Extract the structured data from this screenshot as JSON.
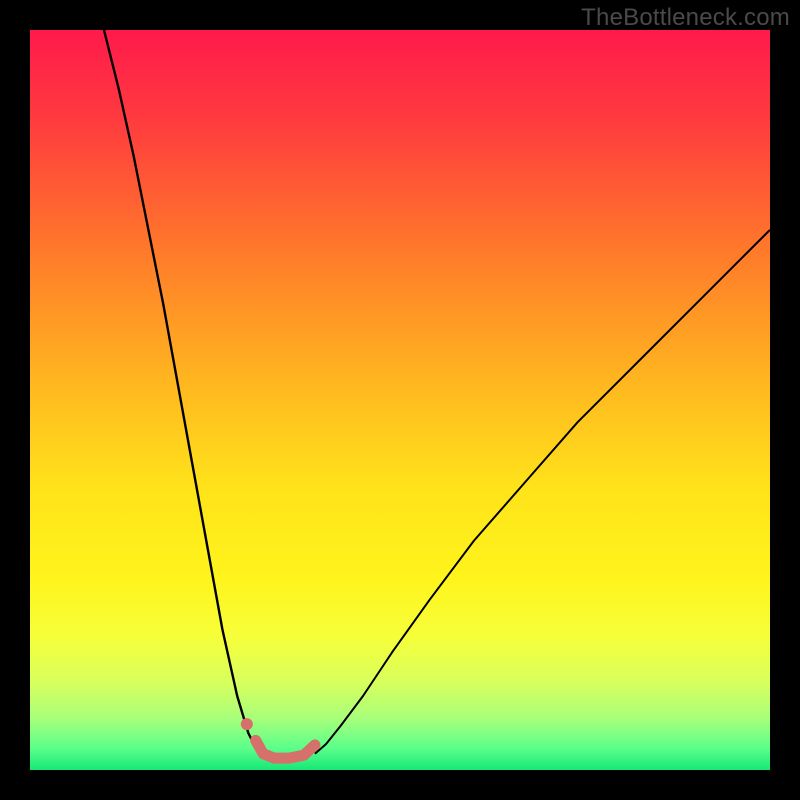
{
  "watermark": "TheBottleneck.com",
  "gradient": {
    "stops": [
      {
        "pct": 0,
        "color": "#ff1a4b"
      },
      {
        "pct": 12,
        "color": "#ff3a3f"
      },
      {
        "pct": 30,
        "color": "#ff7a2a"
      },
      {
        "pct": 48,
        "color": "#ffb81f"
      },
      {
        "pct": 62,
        "color": "#ffe31a"
      },
      {
        "pct": 74,
        "color": "#fff41c"
      },
      {
        "pct": 82,
        "color": "#f6ff3a"
      },
      {
        "pct": 88,
        "color": "#d9ff5c"
      },
      {
        "pct": 93,
        "color": "#a8ff7a"
      },
      {
        "pct": 97,
        "color": "#5cff8a"
      },
      {
        "pct": 100,
        "color": "#17e877"
      }
    ]
  },
  "chart_data": {
    "type": "line",
    "title": "",
    "xlabel": "",
    "ylabel": "",
    "xlim": [
      0,
      100
    ],
    "ylim": [
      0,
      100
    ],
    "grid": false,
    "legend": false,
    "series": [
      {
        "name": "left-curve",
        "stroke": "#000000",
        "stroke_width": 2.4,
        "x": [
          10,
          12,
          14,
          16,
          18,
          20,
          22,
          24,
          26,
          28,
          29.5,
          30.5,
          31.5
        ],
        "y": [
          100,
          92,
          83,
          73,
          63,
          52,
          41,
          30,
          19,
          10,
          5,
          3,
          2.2
        ]
      },
      {
        "name": "right-curve",
        "stroke": "#000000",
        "stroke_width": 2.0,
        "x": [
          38.5,
          40,
          42,
          45,
          49,
          54,
          60,
          67,
          74,
          82,
          90,
          97,
          100
        ],
        "y": [
          2.2,
          3.5,
          6,
          10,
          16,
          23,
          31,
          39,
          47,
          55,
          63,
          70,
          73
        ]
      },
      {
        "name": "floor-marker",
        "stroke": "#d6706a",
        "stroke_width": 11,
        "linecap": "round",
        "x": [
          30.5,
          31.5,
          33,
          35,
          37,
          38.5
        ],
        "y": [
          4.0,
          2.2,
          1.6,
          1.6,
          2.0,
          3.4
        ]
      },
      {
        "name": "dot-marker",
        "type_hint": "scatter",
        "fill": "#d6706a",
        "r": 6,
        "x": [
          29.3
        ],
        "y": [
          6.2
        ]
      }
    ]
  }
}
